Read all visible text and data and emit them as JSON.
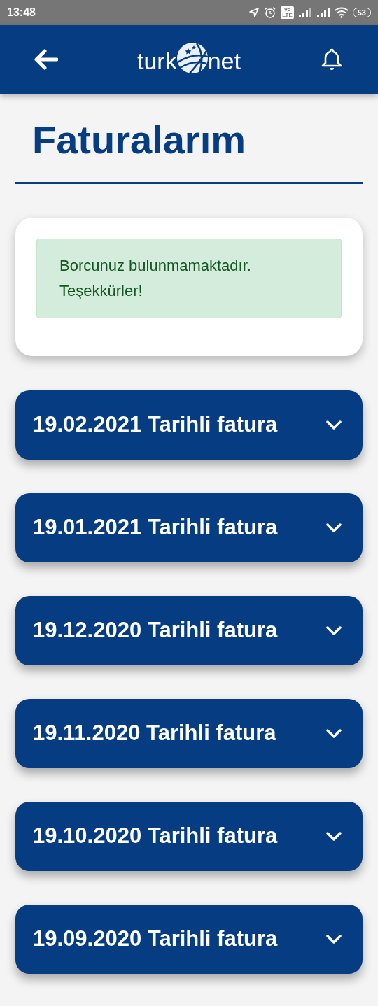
{
  "status_bar": {
    "time": "13:48",
    "volte": "Vo LTE",
    "battery": "53"
  },
  "header": {
    "logo_left": "turk",
    "logo_right": "net"
  },
  "title": "Faturalarım",
  "alert": {
    "message": "Borcunuz bulunmamaktadır. Teşekkürler!"
  },
  "invoices": [
    {
      "label": "19.02.2021 Tarihli fatura",
      "expanded": false
    },
    {
      "label": "19.01.2021 Tarihli fatura",
      "expanded": false
    },
    {
      "label": "19.12.2020 Tarihli fatura",
      "expanded": false
    },
    {
      "label": "19.11.2020 Tarihli fatura",
      "expanded": false
    },
    {
      "label": "19.10.2020 Tarihli fatura",
      "expanded": false
    },
    {
      "label": "19.09.2020 Tarihli fatura",
      "expanded": false
    }
  ]
}
